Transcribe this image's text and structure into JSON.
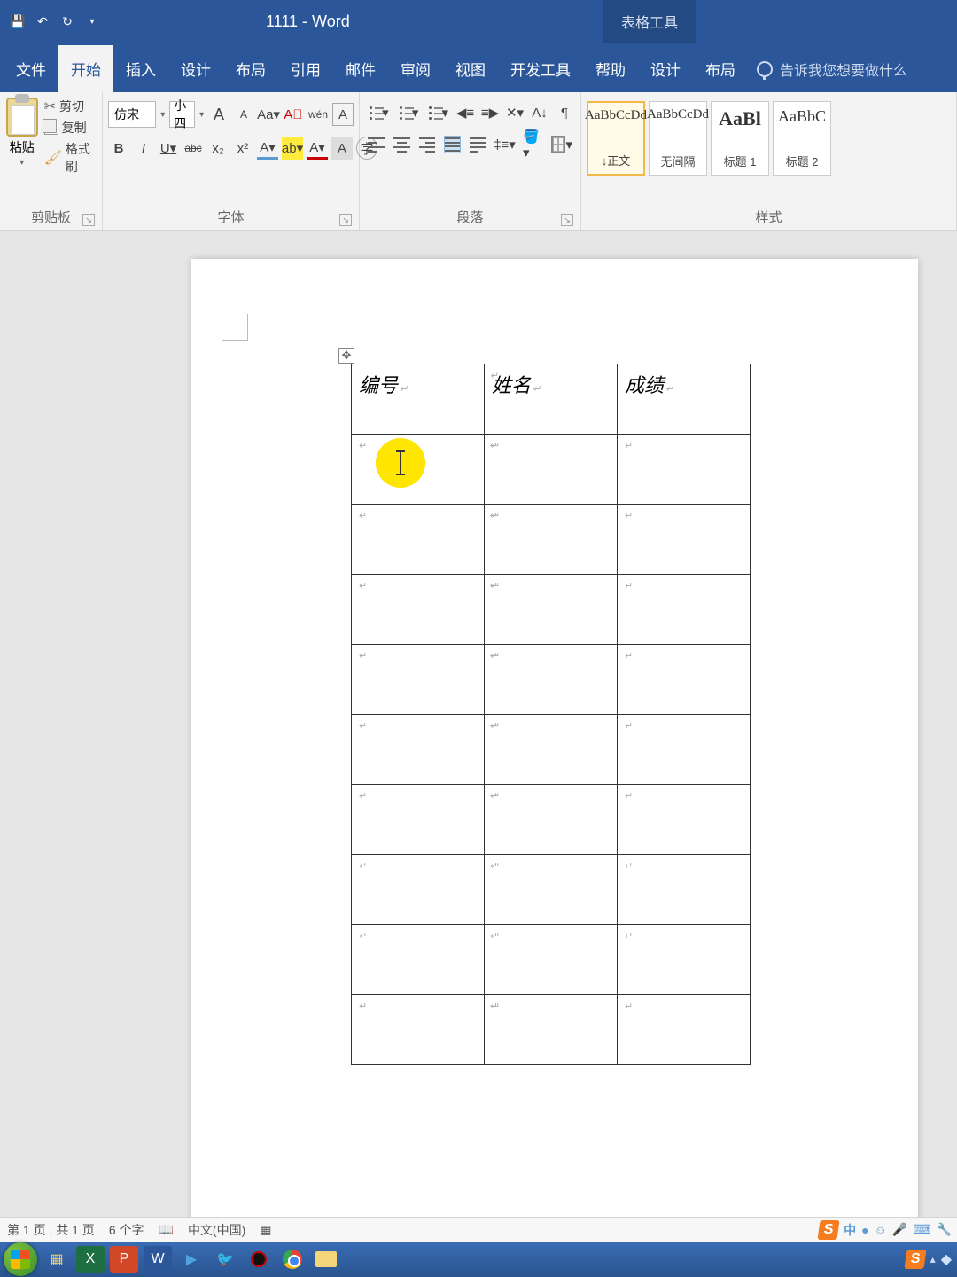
{
  "titlebar": {
    "title": "1111 - Word",
    "table_tools": "表格工具"
  },
  "tabs": {
    "file": "文件",
    "home": "开始",
    "insert": "插入",
    "design": "设计",
    "layout": "布局",
    "references": "引用",
    "mailings": "邮件",
    "review": "审阅",
    "view": "视图",
    "developer": "开发工具",
    "help": "帮助",
    "t_design": "设计",
    "t_layout": "布局",
    "tellme": "告诉我您想要做什么"
  },
  "ribbon": {
    "clipboard": {
      "label": "剪贴板",
      "paste": "粘贴",
      "cut": "剪切",
      "copy": "复制",
      "painter": "格式刷"
    },
    "font": {
      "label": "字体",
      "name": "仿宋",
      "size": "小四",
      "bold": "B",
      "italic": "I",
      "underline": "U",
      "strike": "abc",
      "sub": "x₂",
      "sup": "x²",
      "Aa": "Aa",
      "A_big": "A",
      "A_small": "A",
      "clear": "A",
      "pinyin": "拼",
      "border": "A",
      "circled": "字"
    },
    "paragraph": {
      "label": "段落"
    },
    "styles": {
      "label": "样式",
      "items": [
        {
          "preview": "AaBbCcDd",
          "name": "↓正文"
        },
        {
          "preview": "AaBbCcDd",
          "name": "无间隔"
        },
        {
          "preview": "AaBl",
          "name": "标题 1"
        },
        {
          "preview": "AaBbC",
          "name": "标题 2"
        }
      ]
    }
  },
  "table": {
    "headers": [
      "编号",
      "姓名",
      "成绩"
    ],
    "rows": 9
  },
  "statusbar": {
    "page": "第 1 页 , 共 1 页",
    "words": "6 个字",
    "lang": "中文(中国)",
    "ime": "中"
  }
}
